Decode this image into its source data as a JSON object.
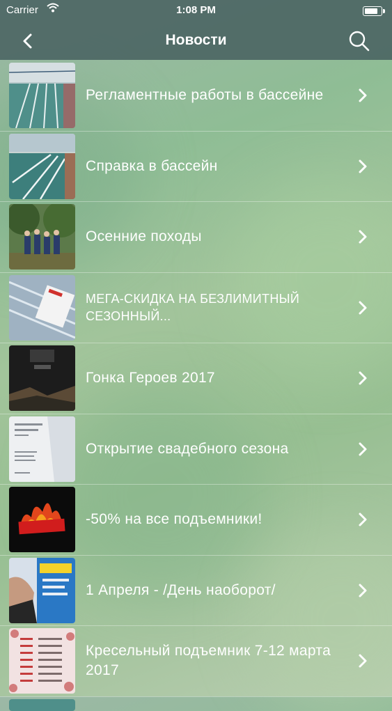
{
  "status_bar": {
    "carrier": "Carrier",
    "time": "1:08 PM",
    "battery_level": 0.9
  },
  "nav": {
    "title": "Новости",
    "back_icon": "chevron-left-icon",
    "search_icon": "search-icon"
  },
  "news": [
    {
      "label": "Регламентные работы в бассейне",
      "thumbnail": "swimming-pool"
    },
    {
      "label": "Справка в бассейн",
      "thumbnail": "swimming-pool"
    },
    {
      "label": "Осенние походы",
      "thumbnail": "group-in-forest"
    },
    {
      "label": "МЕГА-СКИДКА НА БЕЗЛИМИТНЫЙ СЕЗОННЫЙ...",
      "thumbnail": "ski-pass"
    },
    {
      "label": "Гонка Героев 2017",
      "thumbnail": "race-poster"
    },
    {
      "label": "Открытие свадебного сезона",
      "thumbnail": "wedding-flyer"
    },
    {
      "label": "-50% на все подъемники!",
      "thumbnail": "hot-sale"
    },
    {
      "label": "1 Апреля - /День наоборот/",
      "thumbnail": "april-poster"
    },
    {
      "label": "Кресельный подъемник 7-12 марта 2017",
      "thumbnail": "schedule-flyer"
    }
  ],
  "colors": {
    "nav_bg": "#465f5f",
    "text": "#ffffff"
  }
}
